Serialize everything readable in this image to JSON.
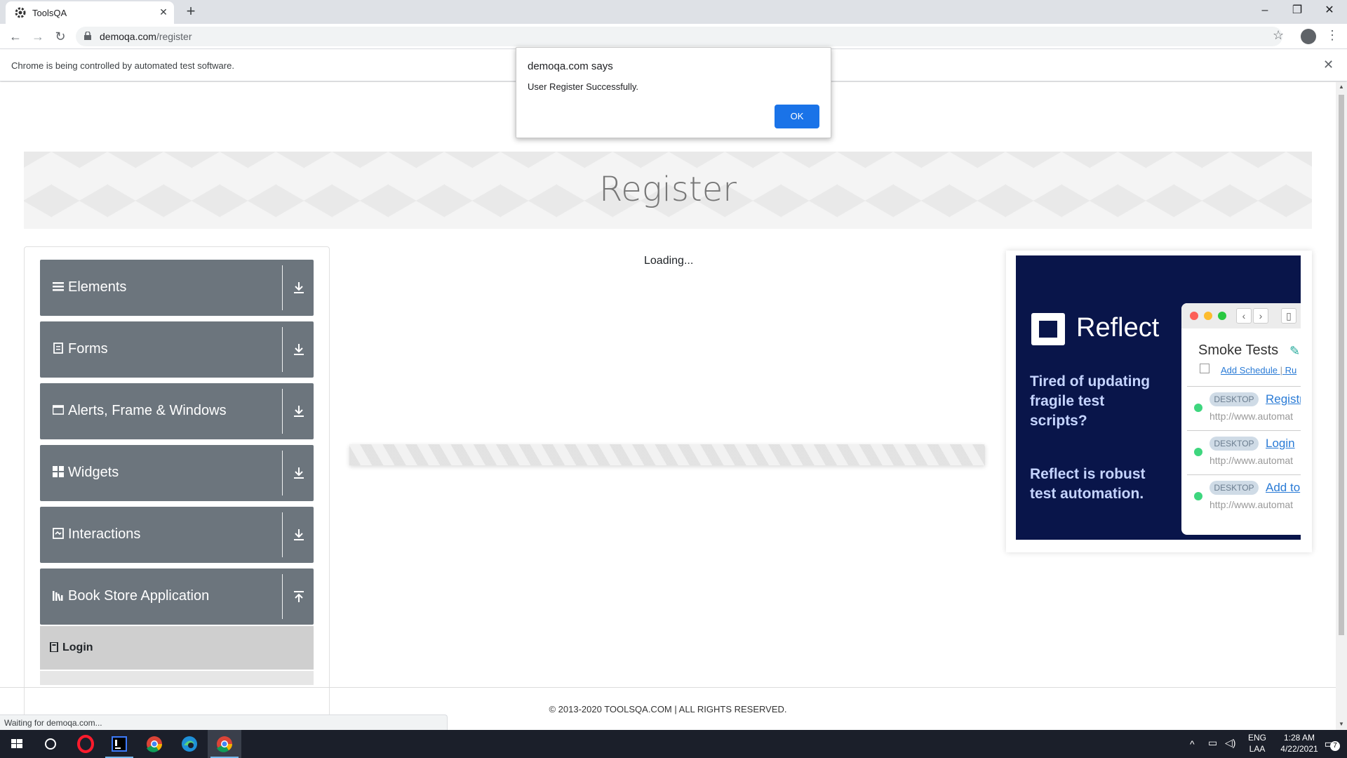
{
  "browser": {
    "tab_title": "ToolsQA",
    "url_host": "demoqa.com",
    "url_path": "/register",
    "infobar_text": "Chrome is being controlled by automated test software.",
    "status_text": "Waiting for demoqa.com..."
  },
  "page": {
    "banner_title": "Register",
    "loading_text": "Loading...",
    "footer_text": "© 2013-2020 TOOLSQA.COM | ALL RIGHTS RESERVED."
  },
  "sidebar": {
    "groups": [
      {
        "label": "Elements",
        "icon": "list-icon"
      },
      {
        "label": "Forms",
        "icon": "document-icon"
      },
      {
        "label": "Alerts, Frame & Windows",
        "icon": "window-icon"
      },
      {
        "label": "Widgets",
        "icon": "grid-icon"
      },
      {
        "label": "Interactions",
        "icon": "interaction-icon"
      },
      {
        "label": "Book Store Application",
        "icon": "books-icon"
      }
    ],
    "subitems": [
      {
        "label": "Login",
        "icon": "book-icon"
      }
    ]
  },
  "ad": {
    "brand": "Reflect",
    "tagline1": "Tired of updating fragile test scripts?",
    "tagline2": "Reflect is robust test automation.",
    "window_title": "Smoke Tests",
    "add_schedule": "Add Schedule",
    "separator": "|",
    "trailing_link": "Ru",
    "rows": [
      {
        "badge": "DESKTOP",
        "link": "Registr",
        "url": "http://www.automat"
      },
      {
        "badge": "DESKTOP",
        "link": "Login",
        "url": "http://www.automat"
      },
      {
        "badge": "DESKTOP",
        "link": "Add to",
        "url": "http://www.automat"
      }
    ]
  },
  "alert": {
    "title": "demoqa.com says",
    "message": "User Register Successfully.",
    "ok_label": "OK"
  },
  "taskbar": {
    "language_line1": "ENG",
    "language_line2": "LAA",
    "time": "1:28 AM",
    "date": "4/22/2021",
    "notification_count": "7"
  },
  "colors": {
    "sidebar_group_bg": "#6c757d",
    "alert_button": "#1a73e8",
    "ad_bg": "#09154a"
  }
}
